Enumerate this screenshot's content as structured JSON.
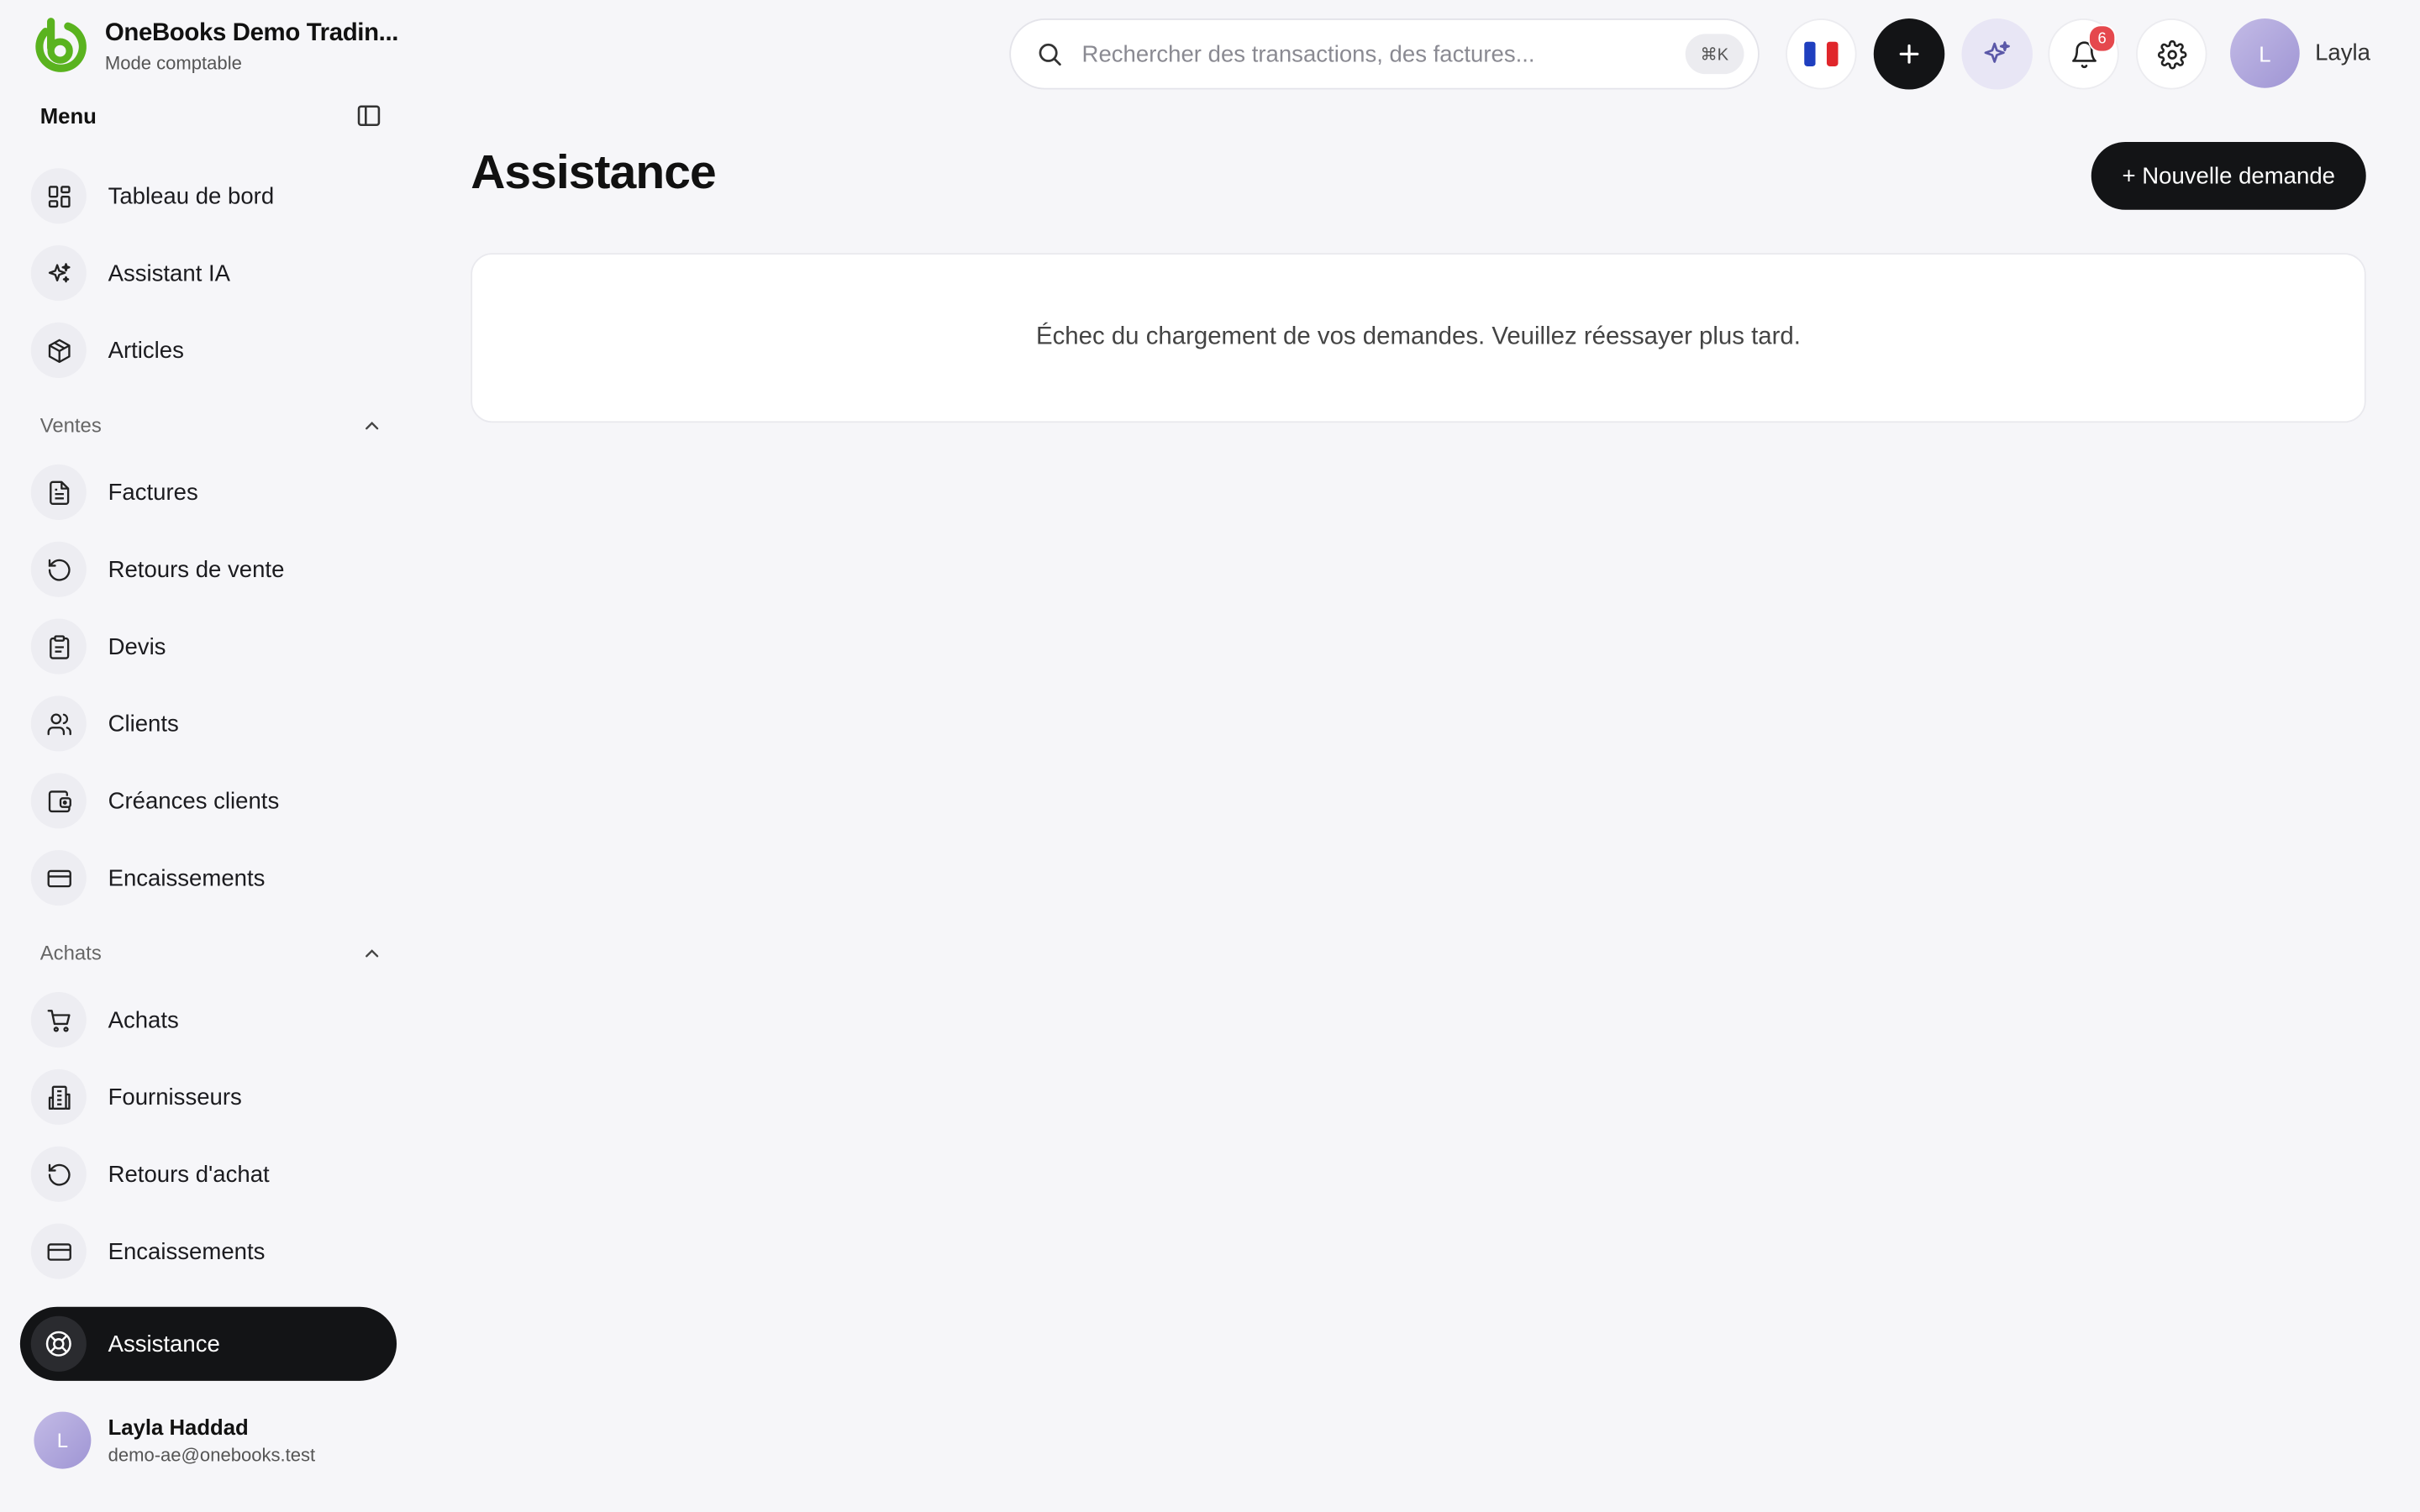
{
  "brand": {
    "name": "OneBooks Demo Tradin...",
    "mode": "Mode comptable",
    "color": "#5ab31f"
  },
  "menu": {
    "title": "Menu"
  },
  "nav": {
    "dashboard": "Tableau de bord",
    "ai_assistant": "Assistant IA",
    "articles": "Articles"
  },
  "sales": {
    "title": "Ventes",
    "items": [
      {
        "label": "Factures",
        "icon": "file-text-icon"
      },
      {
        "label": "Retours de vente",
        "icon": "rotate-ccw-icon"
      },
      {
        "label": "Devis",
        "icon": "clipboard-icon"
      },
      {
        "label": "Clients",
        "icon": "users-icon"
      },
      {
        "label": "Créances clients",
        "icon": "wallet-icon"
      },
      {
        "label": "Encaissements",
        "icon": "credit-card-icon"
      }
    ]
  },
  "purchases": {
    "title": "Achats",
    "items": [
      {
        "label": "Achats",
        "icon": "cart-icon"
      },
      {
        "label": "Fournisseurs",
        "icon": "building-icon"
      },
      {
        "label": "Retours d'achat",
        "icon": "rotate-ccw-icon"
      },
      {
        "label": "Encaissements",
        "icon": "credit-card-icon"
      }
    ]
  },
  "support_nav": {
    "label": "Assistance",
    "active": true
  },
  "profile": {
    "initial": "L",
    "name": "Layla Haddad",
    "email": "demo-ae@onebooks.test"
  },
  "search": {
    "placeholder": "Rechercher des transactions, des factures...",
    "shortcut": "⌘K"
  },
  "topbar": {
    "language": "fr",
    "notifications_count": "6",
    "user_initial": "L",
    "user_name": "Layla"
  },
  "page": {
    "title": "Assistance",
    "new_request_label": "+ Nouvelle demande",
    "error_message": "Échec du chargement de vos demandes. Veuillez réessayer plus tard."
  },
  "colors": {
    "dark": "#131416",
    "background": "#f6f6f9",
    "badge": "#e5484d",
    "avatar": "#b3abe0"
  }
}
